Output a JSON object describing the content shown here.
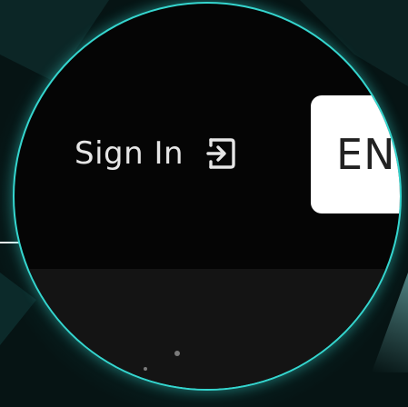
{
  "header": {
    "sign_in_label": "Sign In",
    "language_label": "EN"
  },
  "icons": {
    "sign_in": "sign-in-icon"
  },
  "colors": {
    "accent": "#35d6cf",
    "lens_background": "#050505",
    "text": "#e6e6e6",
    "language_button": "#ffffff"
  }
}
